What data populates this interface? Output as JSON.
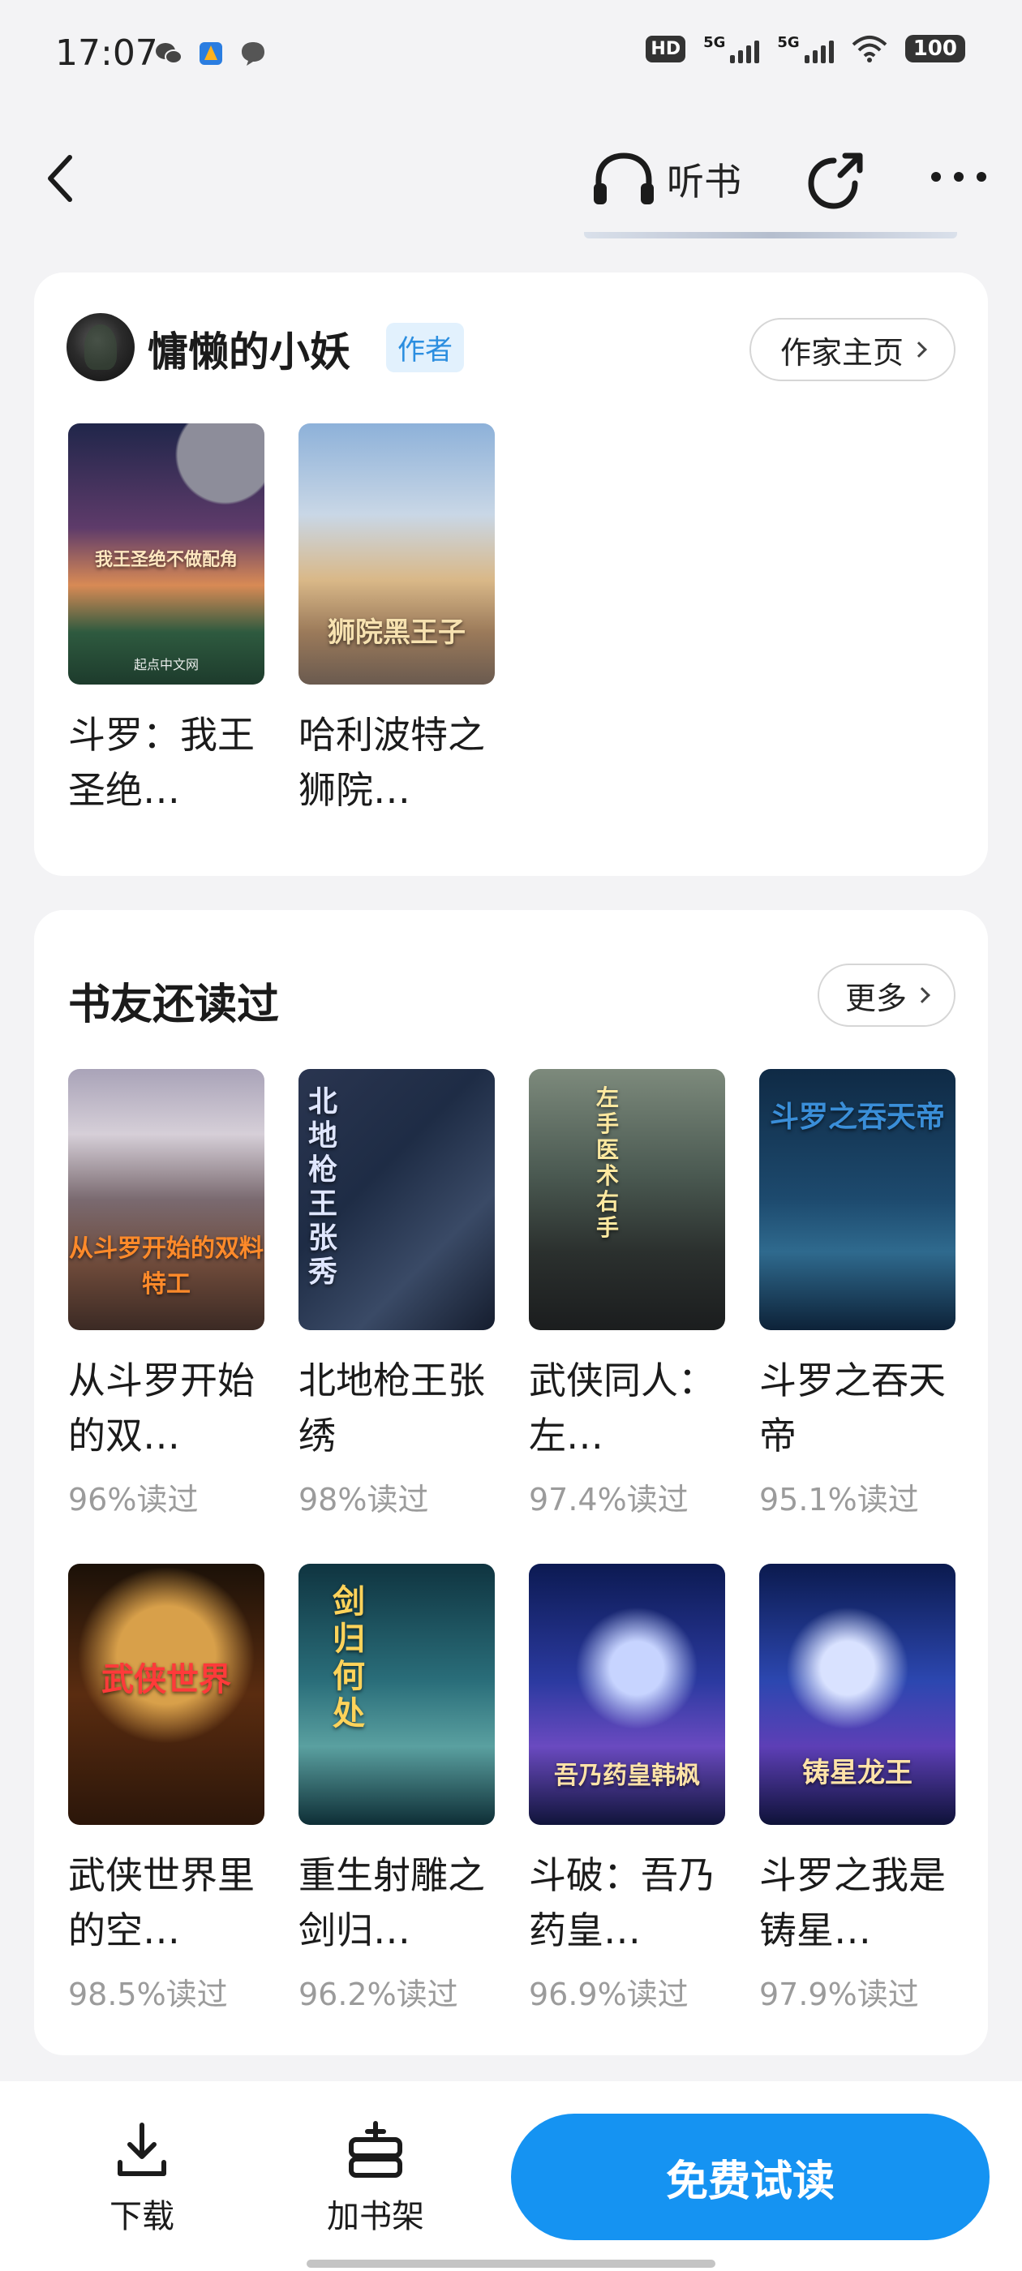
{
  "status_bar": {
    "time": "17:07",
    "hd_badge": "HD",
    "signal1": "5G",
    "signal2": "5G",
    "battery": "100",
    "icons": [
      "wechat-icon",
      "app-icon",
      "message-icon",
      "wifi-icon"
    ]
  },
  "nav": {
    "listen_label": "听书",
    "icons": [
      "back-icon",
      "headphones-icon",
      "share-icon",
      "more-icon"
    ]
  },
  "author_section": {
    "name": "慵懒的小妖",
    "tag": "作者",
    "home_button": "作家主页",
    "books": [
      {
        "title": "斗罗：我王圣绝…",
        "cover_text": "我王圣绝不做配角",
        "publisher": "起点中文网"
      },
      {
        "title": "哈利波特之狮院…",
        "cover_text": "狮院黑王子",
        "publisher": ""
      }
    ]
  },
  "readers_section": {
    "title": "书友还读过",
    "more_button": "更多",
    "books": [
      {
        "title": "从斗罗开始的双…",
        "rate": "96%读过",
        "cover_text": "从斗罗开始的双料特工"
      },
      {
        "title": "北地枪王张绣",
        "rate": "98%读过",
        "cover_text": "北地枪王张秀"
      },
      {
        "title": "武侠同人：左…",
        "rate": "97.4%读过",
        "cover_text": "左手医术右手"
      },
      {
        "title": "斗罗之吞天帝",
        "rate": "95.1%读过",
        "cover_text": "斗罗之吞天帝"
      },
      {
        "title": "武侠世界里的空…",
        "rate": "98.5%读过",
        "cover_text": "武侠世界"
      },
      {
        "title": "重生射雕之剑归…",
        "rate": "96.2%读过",
        "cover_text": "剑归何处"
      },
      {
        "title": "斗破：吾乃药皇…",
        "rate": "96.9%读过",
        "cover_text": "吾乃药皇韩枫"
      },
      {
        "title": "斗罗之我是铸星…",
        "rate": "97.9%读过",
        "cover_text": "铸星龙王"
      }
    ]
  },
  "bottom_bar": {
    "download_label": "下载",
    "shelf_label": "加书架",
    "read_button": "免费试读"
  },
  "colors": {
    "accent": "#1593f2",
    "author_tag_bg": "#e2f1fd",
    "author_tag_text": "#2b8ee0",
    "muted_text": "#9b9b9b"
  }
}
